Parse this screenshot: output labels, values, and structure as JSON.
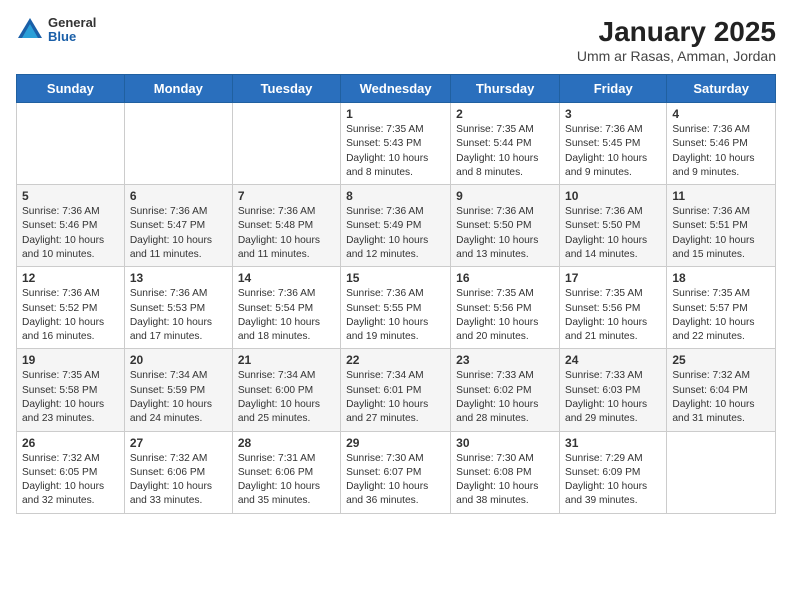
{
  "header": {
    "logo": {
      "general": "General",
      "blue": "Blue"
    },
    "title": "January 2025",
    "subtitle": "Umm ar Rasas, Amman, Jordan"
  },
  "days_of_week": [
    "Sunday",
    "Monday",
    "Tuesday",
    "Wednesday",
    "Thursday",
    "Friday",
    "Saturday"
  ],
  "weeks": [
    [
      {
        "num": "",
        "info": ""
      },
      {
        "num": "",
        "info": ""
      },
      {
        "num": "",
        "info": ""
      },
      {
        "num": "1",
        "info": "Sunrise: 7:35 AM\nSunset: 5:43 PM\nDaylight: 10 hours\nand 8 minutes."
      },
      {
        "num": "2",
        "info": "Sunrise: 7:35 AM\nSunset: 5:44 PM\nDaylight: 10 hours\nand 8 minutes."
      },
      {
        "num": "3",
        "info": "Sunrise: 7:36 AM\nSunset: 5:45 PM\nDaylight: 10 hours\nand 9 minutes."
      },
      {
        "num": "4",
        "info": "Sunrise: 7:36 AM\nSunset: 5:46 PM\nDaylight: 10 hours\nand 9 minutes."
      }
    ],
    [
      {
        "num": "5",
        "info": "Sunrise: 7:36 AM\nSunset: 5:46 PM\nDaylight: 10 hours\nand 10 minutes."
      },
      {
        "num": "6",
        "info": "Sunrise: 7:36 AM\nSunset: 5:47 PM\nDaylight: 10 hours\nand 11 minutes."
      },
      {
        "num": "7",
        "info": "Sunrise: 7:36 AM\nSunset: 5:48 PM\nDaylight: 10 hours\nand 11 minutes."
      },
      {
        "num": "8",
        "info": "Sunrise: 7:36 AM\nSunset: 5:49 PM\nDaylight: 10 hours\nand 12 minutes."
      },
      {
        "num": "9",
        "info": "Sunrise: 7:36 AM\nSunset: 5:50 PM\nDaylight: 10 hours\nand 13 minutes."
      },
      {
        "num": "10",
        "info": "Sunrise: 7:36 AM\nSunset: 5:50 PM\nDaylight: 10 hours\nand 14 minutes."
      },
      {
        "num": "11",
        "info": "Sunrise: 7:36 AM\nSunset: 5:51 PM\nDaylight: 10 hours\nand 15 minutes."
      }
    ],
    [
      {
        "num": "12",
        "info": "Sunrise: 7:36 AM\nSunset: 5:52 PM\nDaylight: 10 hours\nand 16 minutes."
      },
      {
        "num": "13",
        "info": "Sunrise: 7:36 AM\nSunset: 5:53 PM\nDaylight: 10 hours\nand 17 minutes."
      },
      {
        "num": "14",
        "info": "Sunrise: 7:36 AM\nSunset: 5:54 PM\nDaylight: 10 hours\nand 18 minutes."
      },
      {
        "num": "15",
        "info": "Sunrise: 7:36 AM\nSunset: 5:55 PM\nDaylight: 10 hours\nand 19 minutes."
      },
      {
        "num": "16",
        "info": "Sunrise: 7:35 AM\nSunset: 5:56 PM\nDaylight: 10 hours\nand 20 minutes."
      },
      {
        "num": "17",
        "info": "Sunrise: 7:35 AM\nSunset: 5:56 PM\nDaylight: 10 hours\nand 21 minutes."
      },
      {
        "num": "18",
        "info": "Sunrise: 7:35 AM\nSunset: 5:57 PM\nDaylight: 10 hours\nand 22 minutes."
      }
    ],
    [
      {
        "num": "19",
        "info": "Sunrise: 7:35 AM\nSunset: 5:58 PM\nDaylight: 10 hours\nand 23 minutes."
      },
      {
        "num": "20",
        "info": "Sunrise: 7:34 AM\nSunset: 5:59 PM\nDaylight: 10 hours\nand 24 minutes."
      },
      {
        "num": "21",
        "info": "Sunrise: 7:34 AM\nSunset: 6:00 PM\nDaylight: 10 hours\nand 25 minutes."
      },
      {
        "num": "22",
        "info": "Sunrise: 7:34 AM\nSunset: 6:01 PM\nDaylight: 10 hours\nand 27 minutes."
      },
      {
        "num": "23",
        "info": "Sunrise: 7:33 AM\nSunset: 6:02 PM\nDaylight: 10 hours\nand 28 minutes."
      },
      {
        "num": "24",
        "info": "Sunrise: 7:33 AM\nSunset: 6:03 PM\nDaylight: 10 hours\nand 29 minutes."
      },
      {
        "num": "25",
        "info": "Sunrise: 7:32 AM\nSunset: 6:04 PM\nDaylight: 10 hours\nand 31 minutes."
      }
    ],
    [
      {
        "num": "26",
        "info": "Sunrise: 7:32 AM\nSunset: 6:05 PM\nDaylight: 10 hours\nand 32 minutes."
      },
      {
        "num": "27",
        "info": "Sunrise: 7:32 AM\nSunset: 6:06 PM\nDaylight: 10 hours\nand 33 minutes."
      },
      {
        "num": "28",
        "info": "Sunrise: 7:31 AM\nSunset: 6:06 PM\nDaylight: 10 hours\nand 35 minutes."
      },
      {
        "num": "29",
        "info": "Sunrise: 7:30 AM\nSunset: 6:07 PM\nDaylight: 10 hours\nand 36 minutes."
      },
      {
        "num": "30",
        "info": "Sunrise: 7:30 AM\nSunset: 6:08 PM\nDaylight: 10 hours\nand 38 minutes."
      },
      {
        "num": "31",
        "info": "Sunrise: 7:29 AM\nSunset: 6:09 PM\nDaylight: 10 hours\nand 39 minutes."
      },
      {
        "num": "",
        "info": ""
      }
    ]
  ]
}
